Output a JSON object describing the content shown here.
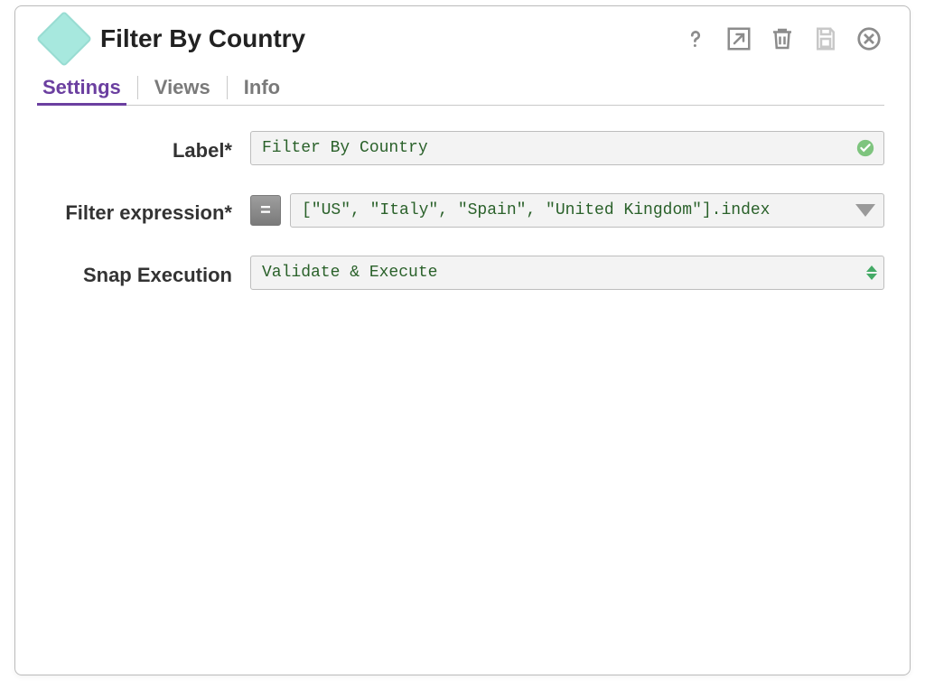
{
  "header": {
    "title": "Filter By Country"
  },
  "tabs": {
    "settings": "Settings",
    "views": "Views",
    "info": "Info",
    "active": "settings"
  },
  "form": {
    "label_field": {
      "label": "Label*",
      "value": "Filter By Country"
    },
    "filter_expression": {
      "label": "Filter expression*",
      "eq": "=",
      "value": "[\"US\", \"Italy\", \"Spain\", \"United Kingdom\"].index"
    },
    "snap_execution": {
      "label": "Snap Execution",
      "value": "Validate & Execute"
    }
  }
}
